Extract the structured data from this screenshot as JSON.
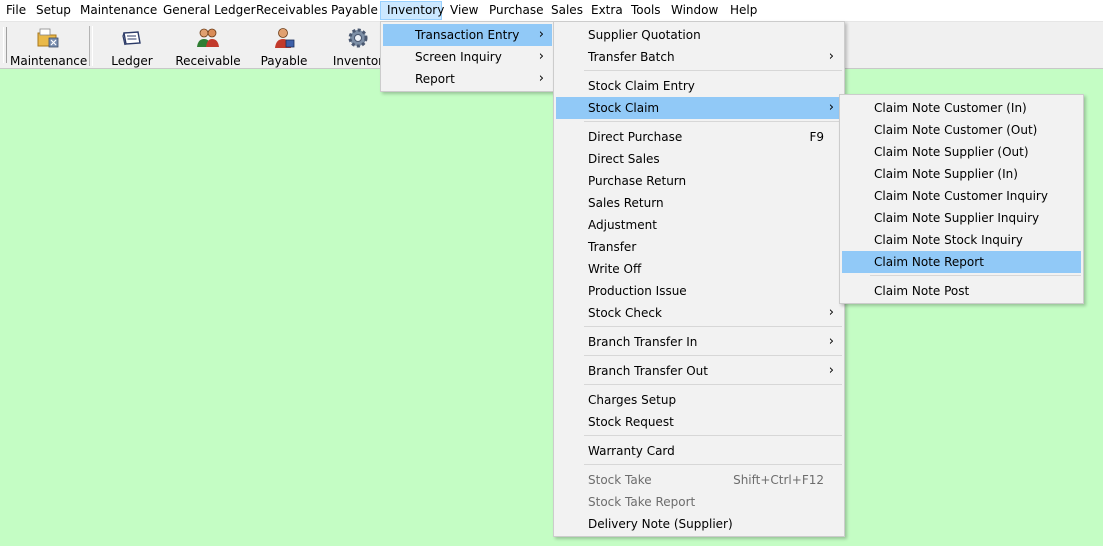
{
  "menubar": {
    "items": [
      {
        "label": "File"
      },
      {
        "label": "Setup"
      },
      {
        "label": "Maintenance"
      },
      {
        "label": "General Ledger"
      },
      {
        "label": "Receivables"
      },
      {
        "label": "Payable"
      },
      {
        "label": "Inventory"
      },
      {
        "label": "View"
      },
      {
        "label": "Purchase"
      },
      {
        "label": "Sales"
      },
      {
        "label": "Extra"
      },
      {
        "label": "Tools"
      },
      {
        "label": "Window"
      },
      {
        "label": "Help"
      }
    ]
  },
  "toolbar": {
    "buttons": [
      {
        "label": "Maintenance",
        "icon": "folder-tools-icon"
      },
      {
        "label": "Ledger",
        "icon": "ledger-book-icon"
      },
      {
        "label": "Receivable",
        "icon": "people-icon"
      },
      {
        "label": "Payable",
        "icon": "person-payable-icon"
      },
      {
        "label": "Inventor",
        "icon": "gear-icon"
      }
    ]
  },
  "inventory_menu": {
    "items": [
      {
        "label": "Transaction Entry",
        "submenu": true,
        "highlighted": true
      },
      {
        "label": "Screen Inquiry",
        "submenu": true
      },
      {
        "label": "Report",
        "submenu": true
      }
    ]
  },
  "transaction_menu": {
    "items": [
      {
        "label": "Supplier Quotation"
      },
      {
        "label": "Transfer Batch",
        "submenu": true
      },
      {
        "label": "Stock Claim Entry"
      },
      {
        "label": "Stock Claim",
        "submenu": true,
        "highlighted": true
      },
      {
        "label": "Direct Purchase",
        "shortcut": "F9"
      },
      {
        "label": "Direct Sales"
      },
      {
        "label": "Purchase Return"
      },
      {
        "label": "Sales Return"
      },
      {
        "label": "Adjustment"
      },
      {
        "label": "Transfer"
      },
      {
        "label": "Write Off"
      },
      {
        "label": "Production Issue"
      },
      {
        "label": "Stock Check",
        "submenu": true
      },
      {
        "label": "Branch Transfer In",
        "submenu": true
      },
      {
        "label": "Branch Transfer Out",
        "submenu": true
      },
      {
        "label": "Charges Setup"
      },
      {
        "label": "Stock Request"
      },
      {
        "label": "Warranty Card"
      },
      {
        "label": "Stock Take",
        "shortcut": "Shift+Ctrl+F12",
        "disabled": true
      },
      {
        "label": "Stock Take Report",
        "disabled": true
      },
      {
        "label": "Delivery Note (Supplier)"
      }
    ]
  },
  "stock_claim_menu": {
    "items": [
      {
        "label": "Claim Note Customer (In)"
      },
      {
        "label": "Claim Note Customer (Out)"
      },
      {
        "label": "Claim Note Supplier (Out)"
      },
      {
        "label": "Claim Note Supplier (In)"
      },
      {
        "label": "Claim Note Customer Inquiry"
      },
      {
        "label": "Claim Note Supplier Inquiry"
      },
      {
        "label": "Claim Note Stock Inquiry"
      },
      {
        "label": "Claim Note Report",
        "highlighted": true
      },
      {
        "label": "Claim Note Post"
      }
    ]
  },
  "colors": {
    "desktop_background": "#c4fdc4",
    "menu_highlight": "#91c9f7",
    "menubar_active": "#cce8ff"
  }
}
